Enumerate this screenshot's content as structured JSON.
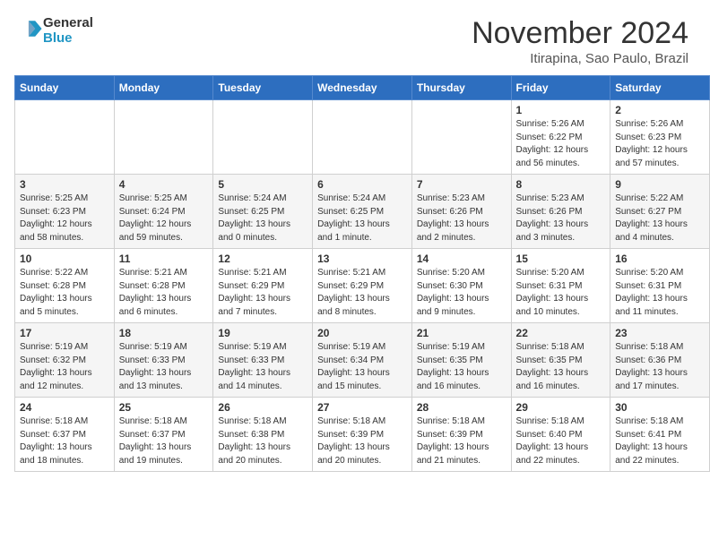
{
  "header": {
    "logo_text1": "General",
    "logo_text2": "Blue",
    "month": "November 2024",
    "location": "Itirapina, Sao Paulo, Brazil"
  },
  "days_of_week": [
    "Sunday",
    "Monday",
    "Tuesday",
    "Wednesday",
    "Thursday",
    "Friday",
    "Saturday"
  ],
  "weeks": [
    [
      {
        "day": "",
        "info": ""
      },
      {
        "day": "",
        "info": ""
      },
      {
        "day": "",
        "info": ""
      },
      {
        "day": "",
        "info": ""
      },
      {
        "day": "",
        "info": ""
      },
      {
        "day": "1",
        "info": "Sunrise: 5:26 AM\nSunset: 6:22 PM\nDaylight: 12 hours\nand 56 minutes."
      },
      {
        "day": "2",
        "info": "Sunrise: 5:26 AM\nSunset: 6:23 PM\nDaylight: 12 hours\nand 57 minutes."
      }
    ],
    [
      {
        "day": "3",
        "info": "Sunrise: 5:25 AM\nSunset: 6:23 PM\nDaylight: 12 hours\nand 58 minutes."
      },
      {
        "day": "4",
        "info": "Sunrise: 5:25 AM\nSunset: 6:24 PM\nDaylight: 12 hours\nand 59 minutes."
      },
      {
        "day": "5",
        "info": "Sunrise: 5:24 AM\nSunset: 6:25 PM\nDaylight: 13 hours\nand 0 minutes."
      },
      {
        "day": "6",
        "info": "Sunrise: 5:24 AM\nSunset: 6:25 PM\nDaylight: 13 hours\nand 1 minute."
      },
      {
        "day": "7",
        "info": "Sunrise: 5:23 AM\nSunset: 6:26 PM\nDaylight: 13 hours\nand 2 minutes."
      },
      {
        "day": "8",
        "info": "Sunrise: 5:23 AM\nSunset: 6:26 PM\nDaylight: 13 hours\nand 3 minutes."
      },
      {
        "day": "9",
        "info": "Sunrise: 5:22 AM\nSunset: 6:27 PM\nDaylight: 13 hours\nand 4 minutes."
      }
    ],
    [
      {
        "day": "10",
        "info": "Sunrise: 5:22 AM\nSunset: 6:28 PM\nDaylight: 13 hours\nand 5 minutes."
      },
      {
        "day": "11",
        "info": "Sunrise: 5:21 AM\nSunset: 6:28 PM\nDaylight: 13 hours\nand 6 minutes."
      },
      {
        "day": "12",
        "info": "Sunrise: 5:21 AM\nSunset: 6:29 PM\nDaylight: 13 hours\nand 7 minutes."
      },
      {
        "day": "13",
        "info": "Sunrise: 5:21 AM\nSunset: 6:29 PM\nDaylight: 13 hours\nand 8 minutes."
      },
      {
        "day": "14",
        "info": "Sunrise: 5:20 AM\nSunset: 6:30 PM\nDaylight: 13 hours\nand 9 minutes."
      },
      {
        "day": "15",
        "info": "Sunrise: 5:20 AM\nSunset: 6:31 PM\nDaylight: 13 hours\nand 10 minutes."
      },
      {
        "day": "16",
        "info": "Sunrise: 5:20 AM\nSunset: 6:31 PM\nDaylight: 13 hours\nand 11 minutes."
      }
    ],
    [
      {
        "day": "17",
        "info": "Sunrise: 5:19 AM\nSunset: 6:32 PM\nDaylight: 13 hours\nand 12 minutes."
      },
      {
        "day": "18",
        "info": "Sunrise: 5:19 AM\nSunset: 6:33 PM\nDaylight: 13 hours\nand 13 minutes."
      },
      {
        "day": "19",
        "info": "Sunrise: 5:19 AM\nSunset: 6:33 PM\nDaylight: 13 hours\nand 14 minutes."
      },
      {
        "day": "20",
        "info": "Sunrise: 5:19 AM\nSunset: 6:34 PM\nDaylight: 13 hours\nand 15 minutes."
      },
      {
        "day": "21",
        "info": "Sunrise: 5:19 AM\nSunset: 6:35 PM\nDaylight: 13 hours\nand 16 minutes."
      },
      {
        "day": "22",
        "info": "Sunrise: 5:18 AM\nSunset: 6:35 PM\nDaylight: 13 hours\nand 16 minutes."
      },
      {
        "day": "23",
        "info": "Sunrise: 5:18 AM\nSunset: 6:36 PM\nDaylight: 13 hours\nand 17 minutes."
      }
    ],
    [
      {
        "day": "24",
        "info": "Sunrise: 5:18 AM\nSunset: 6:37 PM\nDaylight: 13 hours\nand 18 minutes."
      },
      {
        "day": "25",
        "info": "Sunrise: 5:18 AM\nSunset: 6:37 PM\nDaylight: 13 hours\nand 19 minutes."
      },
      {
        "day": "26",
        "info": "Sunrise: 5:18 AM\nSunset: 6:38 PM\nDaylight: 13 hours\nand 20 minutes."
      },
      {
        "day": "27",
        "info": "Sunrise: 5:18 AM\nSunset: 6:39 PM\nDaylight: 13 hours\nand 20 minutes."
      },
      {
        "day": "28",
        "info": "Sunrise: 5:18 AM\nSunset: 6:39 PM\nDaylight: 13 hours\nand 21 minutes."
      },
      {
        "day": "29",
        "info": "Sunrise: 5:18 AM\nSunset: 6:40 PM\nDaylight: 13 hours\nand 22 minutes."
      },
      {
        "day": "30",
        "info": "Sunrise: 5:18 AM\nSunset: 6:41 PM\nDaylight: 13 hours\nand 22 minutes."
      }
    ]
  ]
}
